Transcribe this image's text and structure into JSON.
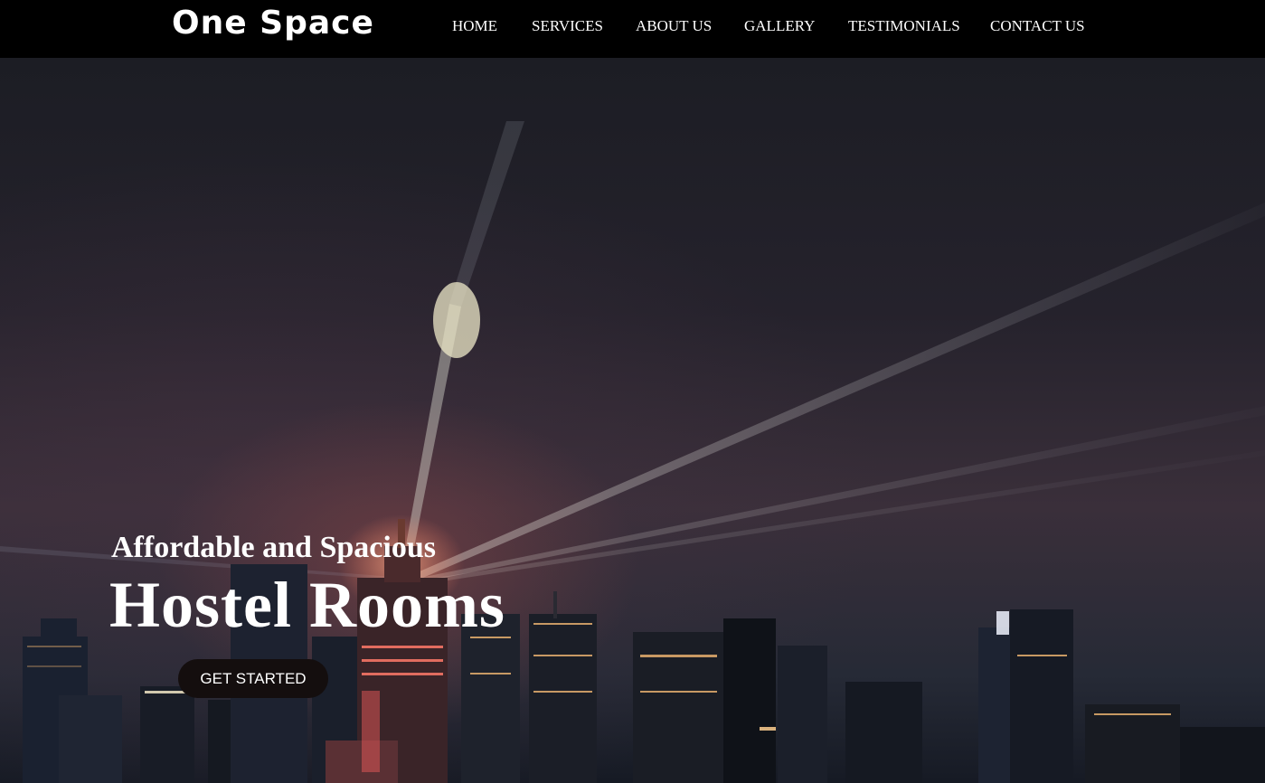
{
  "header": {
    "logo_text": "One Space",
    "nav": [
      {
        "label": "HOME"
      },
      {
        "label": "SERVICES"
      },
      {
        "label": "ABOUT US"
      },
      {
        "label": "GALLERY"
      },
      {
        "label": "TESTIMONIALS"
      },
      {
        "label": "CONTACT US"
      }
    ]
  },
  "hero": {
    "subtitle": "Affordable and Spacious",
    "title": "Hostel Rooms",
    "cta_label": "GET STARTED"
  },
  "colors": {
    "navbar_bg": "#000000",
    "text": "#ffffff",
    "cta_bg": "#140e0e"
  }
}
